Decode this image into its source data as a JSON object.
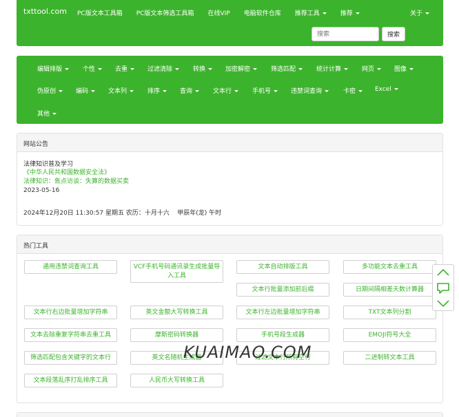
{
  "site": {
    "brand": "txttool.com",
    "nav": [
      "PC版文本工具箱",
      "PC版文本筛选工具箱",
      "在线VIP",
      "电脑软件仓库",
      "推荐工具",
      "推荐"
    ],
    "about": "关于",
    "search_placeholder": "搜索",
    "search_button": "搜索"
  },
  "categories": [
    "编辑排版",
    "个性",
    "去重",
    "过滤清除",
    "转换",
    "加密解密",
    "筛选匹配",
    "统计计算",
    "网页",
    "图像",
    "伪原创",
    "编码",
    "文本列",
    "排序",
    "查询",
    "文本行",
    "手机号",
    "违禁词查询",
    "卡密",
    "Excel",
    "其他"
  ],
  "notice": {
    "title": "网站公告",
    "line1": "法律知识普及学习",
    "line2": "《中华人民共和国数据安全法》",
    "line3": "法律知识：焦点访谈：失算的数据买卖",
    "line4": "2023-05-16",
    "datetime": "2024年12月20日 11:30:57 星期五 农历：十月十六    甲辰年(龙) 午时"
  },
  "hot": {
    "title": "热门工具",
    "tools": [
      "通用违禁词查询工具",
      "VCF手机号码通讯录生成批量导入工具",
      "文本自动排版工具",
      "多功能文本去重工具",
      "文本行批量添加前后缀",
      "日期间隔相差天数计算器",
      "文本行右边批量增加字符串",
      "英文金额大写转换工具",
      "文本行左边批量增加字符串",
      "TXT文本列分割",
      "文本去除重复字符串去重工具",
      "摩斯密码转换器",
      "手机号段生成器",
      "EMOJI符号大全",
      "筛选匹配包含关键字的文本行",
      "英文名随机生成器",
      "过滤文本行所有空行",
      "二进制转文本工具",
      "文本段落乱序打乱排序工具",
      "人民币大写转换工具"
    ]
  },
  "watermark": "KUAIMAO.COM",
  "colors": {
    "brand_green": "#3cb32c"
  },
  "icons": [
    "chevron-up-icon",
    "comment-icon",
    "chevron-down-icon"
  ]
}
